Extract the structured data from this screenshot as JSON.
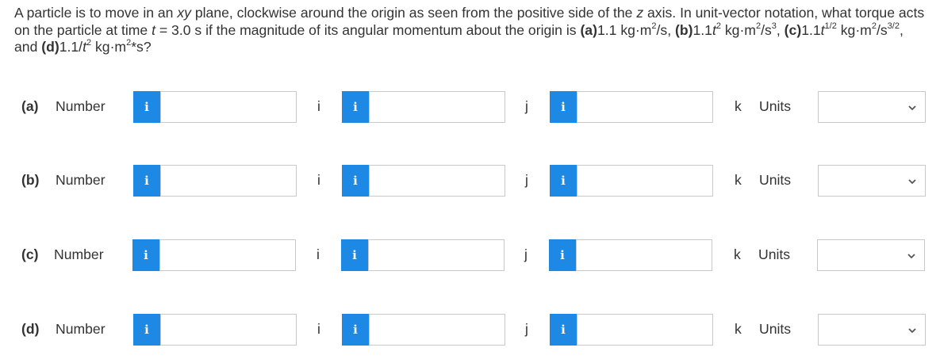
{
  "question": {
    "intro": "A particle is to move in an ",
    "xy": "xy",
    "mid1": " plane, clockwise around the origin as seen from the positive side of the ",
    "z": "z",
    "mid2": " axis. In unit-vector notation, what torque acts on the particle at time ",
    "t": "t",
    "mid3": " = 3.0 s if the magnitude of its angular momentum about the origin is ",
    "a_tag": "(a)",
    "a_val": "1.1 kg·m",
    "a_exp1": "2",
    "a_tail": "/s, ",
    "b_tag": "(b)",
    "b_val": "1.1",
    "b_t": "t",
    "b_exp1": "2",
    "b_units": " kg·m",
    "b_exp2": "2",
    "b_units2": "/s",
    "b_exp3": "3",
    "b_tail": ", ",
    "c_tag": "(c)",
    "c_val": "1.1",
    "c_t": "t",
    "c_exp1": "1/2",
    "c_units": " kg·m",
    "c_exp2": "2",
    "c_units2": "/s",
    "c_exp3": "3/2",
    "c_tail": ", and ",
    "d_tag": "(d)",
    "d_val": "1.1/",
    "d_t": "t",
    "d_exp1": "2",
    "d_units": " kg·m",
    "d_exp2": "2",
    "d_units2": "*s?"
  },
  "parts": [
    {
      "tag": "(a)",
      "number_label": "Number",
      "i_label": "i",
      "j_label": "j",
      "k_label": "k",
      "units_label": "Units",
      "info_glyph": "i",
      "value_i": "",
      "value_j": "",
      "value_k": "",
      "units_value": ""
    },
    {
      "tag": "(b)",
      "number_label": "Number",
      "i_label": "i",
      "j_label": "j",
      "k_label": "k",
      "units_label": "Units",
      "info_glyph": "i",
      "value_i": "",
      "value_j": "",
      "value_k": "",
      "units_value": ""
    },
    {
      "tag": "(c)",
      "number_label": "Number",
      "i_label": "i",
      "j_label": "j",
      "k_label": "k",
      "units_label": "Units",
      "info_glyph": "i",
      "value_i": "",
      "value_j": "",
      "value_k": "",
      "units_value": ""
    },
    {
      "tag": "(d)",
      "number_label": "Number",
      "i_label": "i",
      "j_label": "j",
      "k_label": "k",
      "units_label": "Units",
      "info_glyph": "i",
      "value_i": "",
      "value_j": "",
      "value_k": "",
      "units_value": ""
    }
  ],
  "colors": {
    "info_button": "#1e88e5",
    "text": "#333333",
    "input_border": "#c9c9c9"
  },
  "icons": {
    "info": "info-icon",
    "dropdown": "chevron-down-icon"
  }
}
